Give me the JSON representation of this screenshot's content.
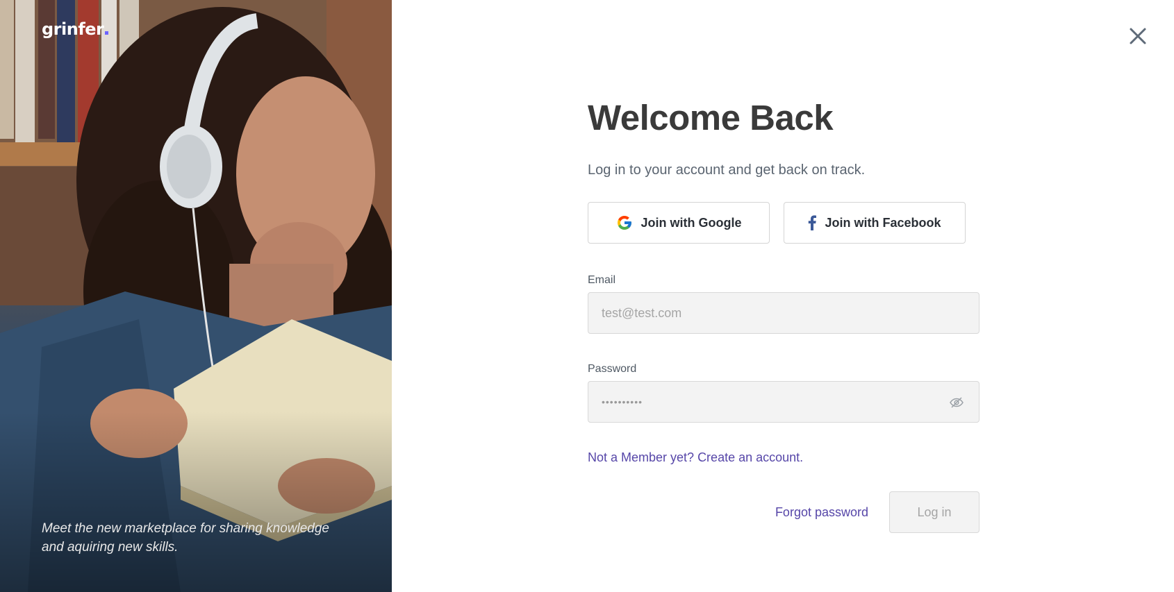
{
  "brand": {
    "name": "grinfer",
    "accent_color": "#6c63ff"
  },
  "hero": {
    "image": "student-with-headphones-reading-book",
    "tagline": "Meet the new marketplace for sharing knowledge and aquiring new skills."
  },
  "close": {
    "icon": "close-icon"
  },
  "form": {
    "title": "Welcome Back",
    "subtitle": "Log in to your account and get back on track.",
    "social": {
      "google_label": "Join with Google",
      "facebook_label": "Join with Facebook"
    },
    "email": {
      "label": "Email",
      "placeholder": "test@test.com",
      "value": ""
    },
    "password": {
      "label": "Password",
      "value": "••••••••••",
      "toggle_icon": "eye-off-icon"
    },
    "signup_link": "Not a Member yet? Create an account.",
    "forgot_link": "Forgot password",
    "login_label": "Log in"
  },
  "colors": {
    "link": "#5646a8",
    "title": "#3a3a3a",
    "input_bg": "#f3f3f3"
  }
}
